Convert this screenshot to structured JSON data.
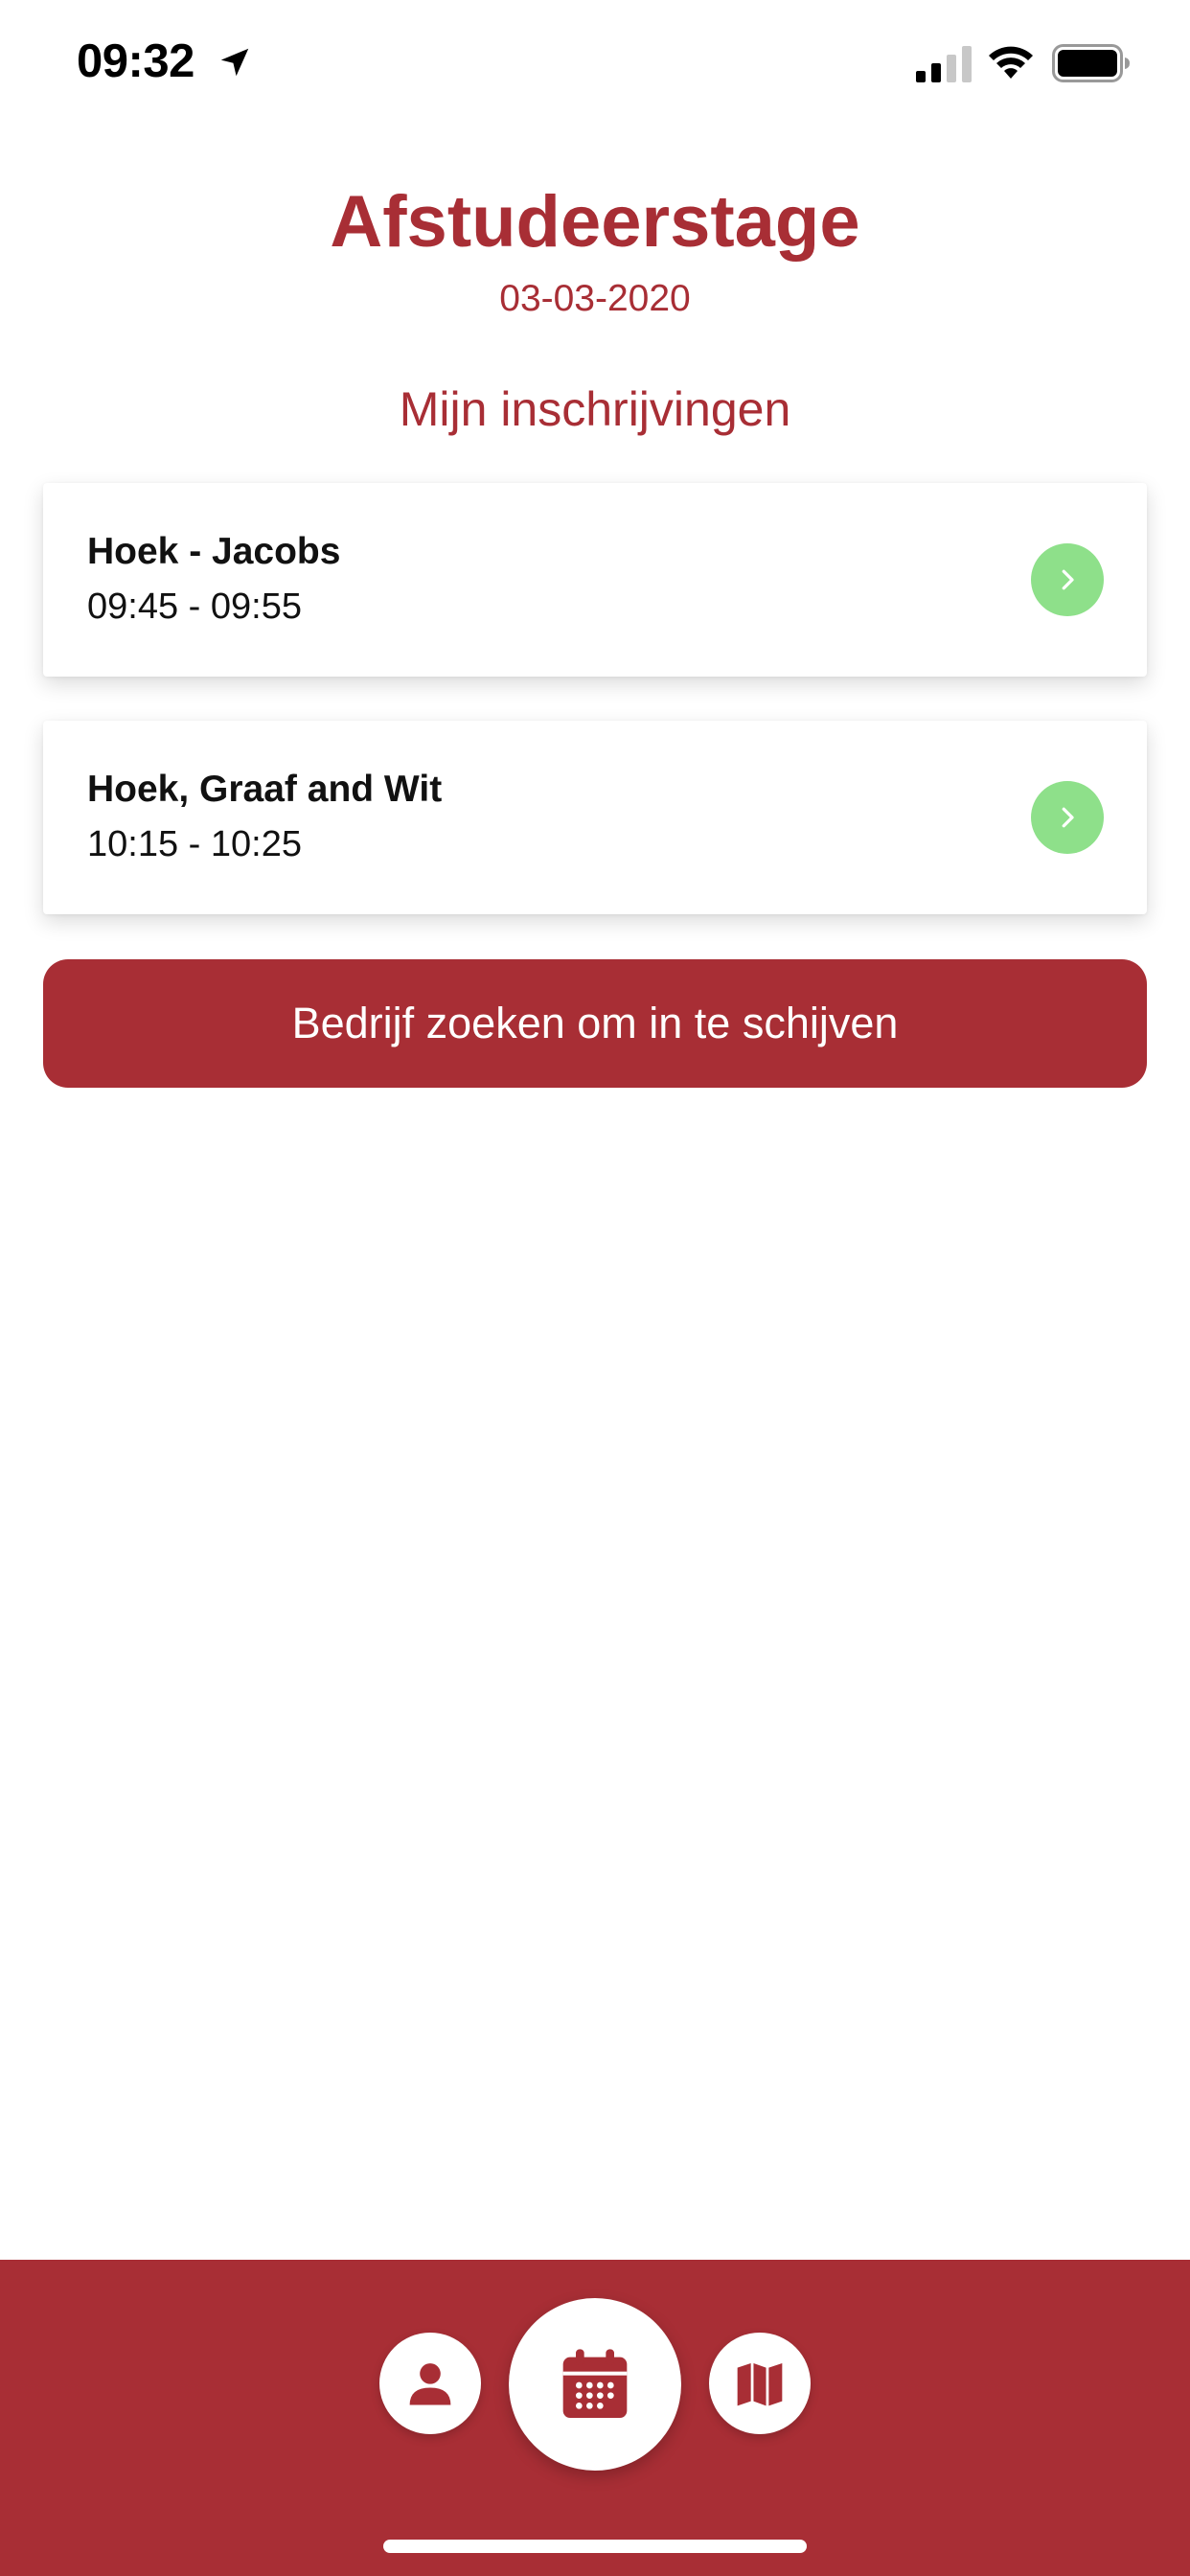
{
  "status_bar": {
    "time": "09:32",
    "icons": [
      "location-arrow-icon",
      "cellular-signal-icon",
      "wifi-icon",
      "battery-icon"
    ]
  },
  "header": {
    "title": "Afstudeerstage",
    "date": "03-03-2020"
  },
  "registrations": {
    "heading": "Mijn inschrijvingen",
    "items": [
      {
        "company": "Hoek - Jacobs",
        "time": "09:45 - 09:55",
        "icon": "chevron-right-icon"
      },
      {
        "company": "Hoek, Graaf and Wit",
        "time": "10:15 - 10:25",
        "icon": "chevron-right-icon"
      }
    ]
  },
  "actions": {
    "search_label": "Bedrijf zoeken om in te schijven"
  },
  "bottom_nav": {
    "items": [
      {
        "icon": "person-icon"
      },
      {
        "icon": "calendar-icon",
        "active": true
      },
      {
        "icon": "map-icon"
      }
    ]
  },
  "colors": {
    "brand": "#a82e35",
    "accent_green": "#8ee08a",
    "background": "#ffffff",
    "text": "#111111"
  }
}
